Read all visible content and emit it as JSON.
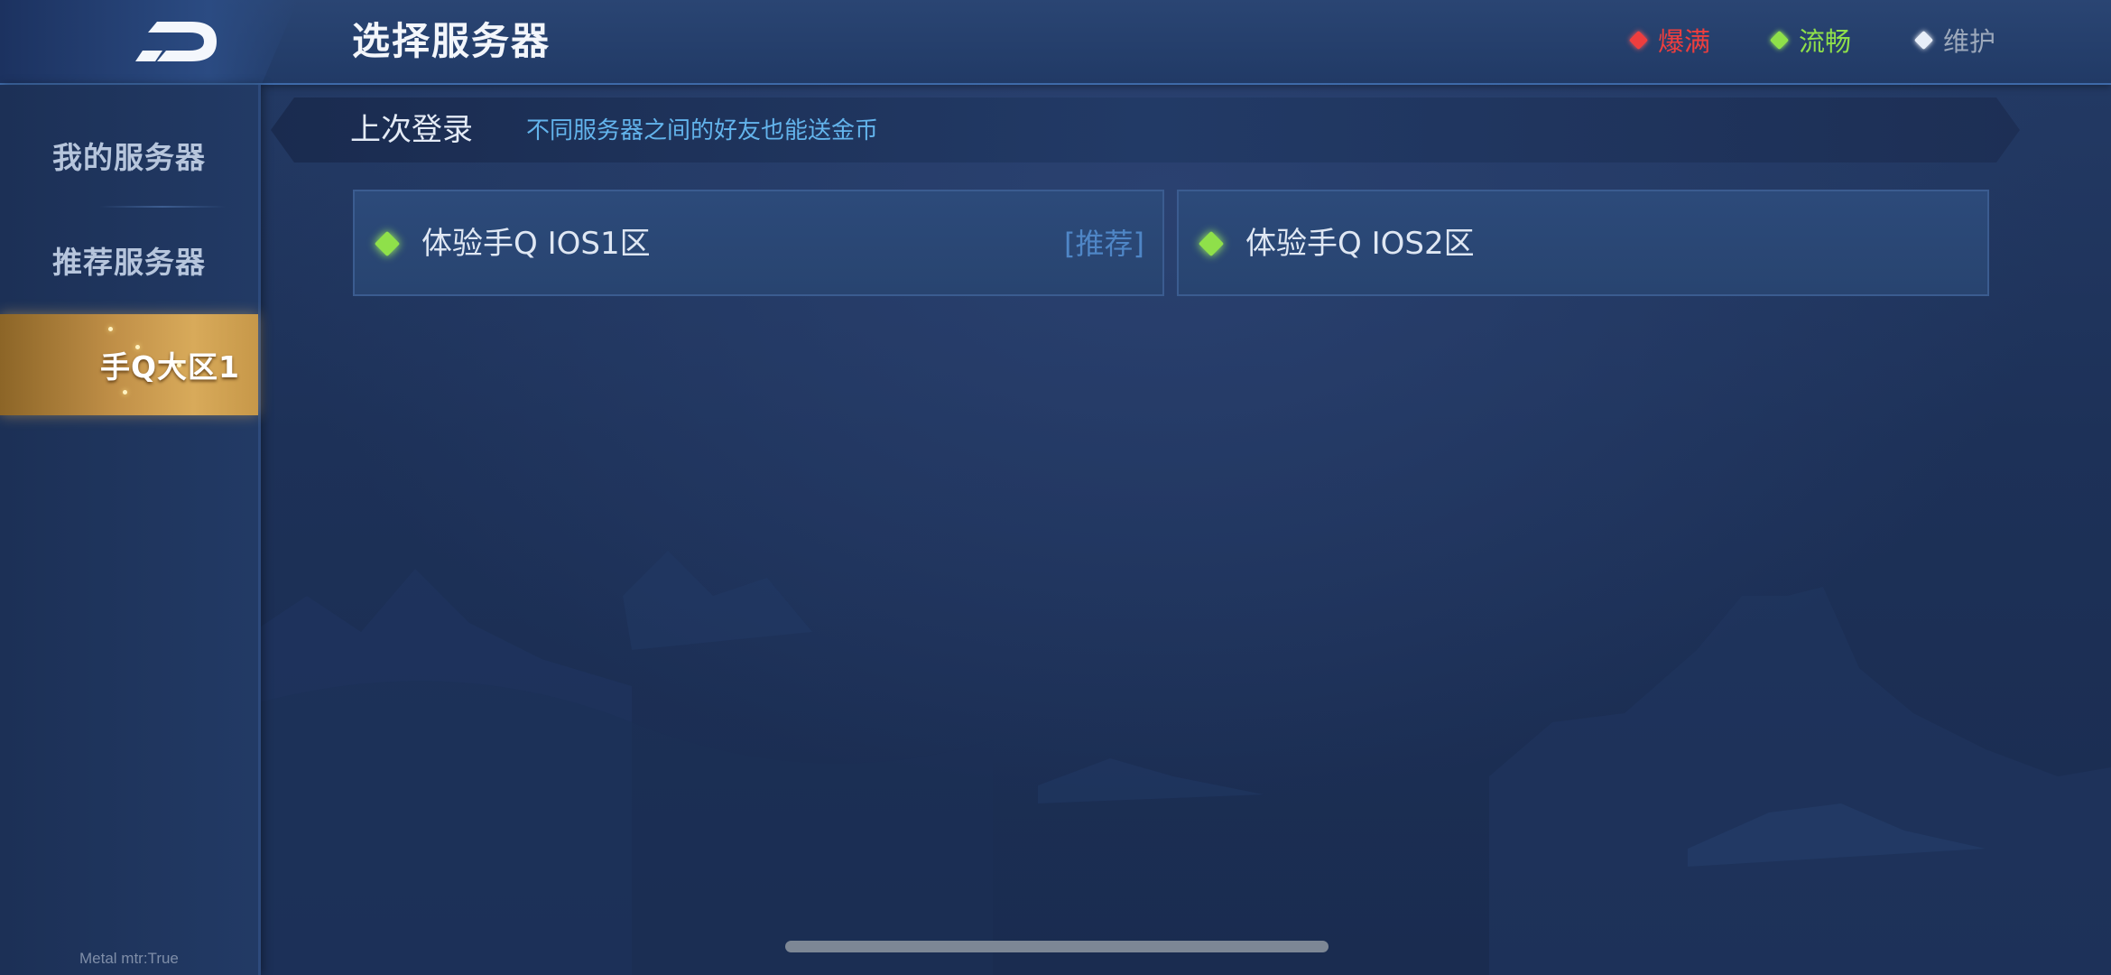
{
  "header": {
    "title": "选择服务器",
    "back_icon": "back-arrow-icon",
    "legend": [
      {
        "label": "爆满",
        "color": "#ee3e3e"
      },
      {
        "label": "流畅",
        "color": "#8fe04a"
      },
      {
        "label": "维护",
        "color": "#e8eef8"
      }
    ]
  },
  "sidebar": {
    "items": [
      {
        "label": "我的服务器",
        "active": false
      },
      {
        "label": "推荐服务器",
        "active": false
      },
      {
        "label": "手Q大区1",
        "active": true
      }
    ],
    "debug_text": "Metal mtr:True"
  },
  "main": {
    "banner": {
      "title": "上次登录",
      "tip": "不同服务器之间的好友也能送金币"
    },
    "servers": [
      {
        "name": "体验手Q IOS1区",
        "tag": "[推荐]",
        "status_color": "#8fe04a"
      },
      {
        "name": "体验手Q IOS2区",
        "tag": "",
        "status_color": "#8fe04a"
      }
    ]
  },
  "colors": {
    "background": "#1d3158",
    "accent_gold": "#c19048",
    "link_blue": "#63b4ec"
  }
}
